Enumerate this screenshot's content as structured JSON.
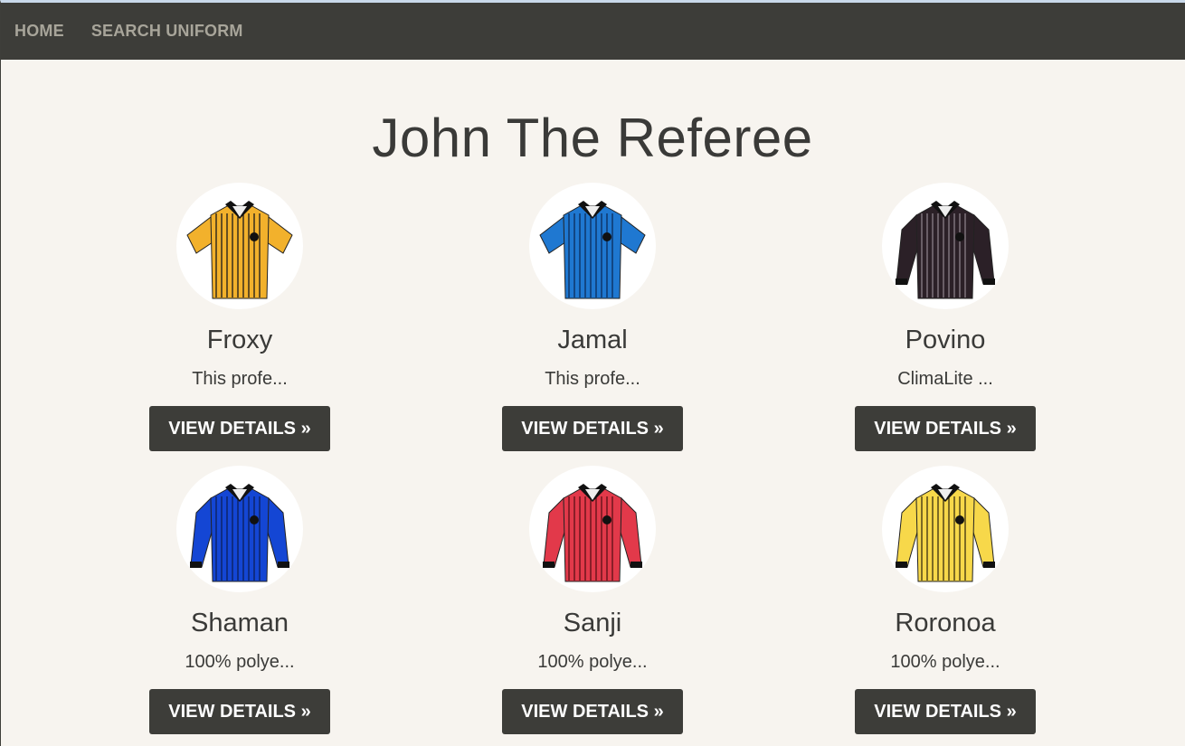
{
  "nav": {
    "home": "HOME",
    "search": "SEARCH UNIFORM"
  },
  "page": {
    "title": "John The Referee"
  },
  "button_label": "VIEW DETAILS »",
  "uniforms": [
    {
      "name": "Froxy",
      "desc": "This profe...",
      "color": "#f2b12c",
      "stripe": "#1a1a1a",
      "sleeve": "short"
    },
    {
      "name": "Jamal",
      "desc": "This profe...",
      "color": "#1f78d1",
      "stripe": "#0d2d5a",
      "sleeve": "short"
    },
    {
      "name": "Povino",
      "desc": "ClimaLite ...",
      "color": "#2b2027",
      "stripe": "#8a7f88",
      "sleeve": "long"
    },
    {
      "name": "Shaman",
      "desc": "100% polye...",
      "color": "#1446d4",
      "stripe": "#0b1e5a",
      "sleeve": "long"
    },
    {
      "name": "Sanji",
      "desc": "100% polye...",
      "color": "#e2394a",
      "stripe": "#5a1016",
      "sleeve": "long"
    },
    {
      "name": "Roronoa",
      "desc": "100% polye...",
      "color": "#f7d84a",
      "stripe": "#3a3010",
      "sleeve": "long"
    }
  ]
}
